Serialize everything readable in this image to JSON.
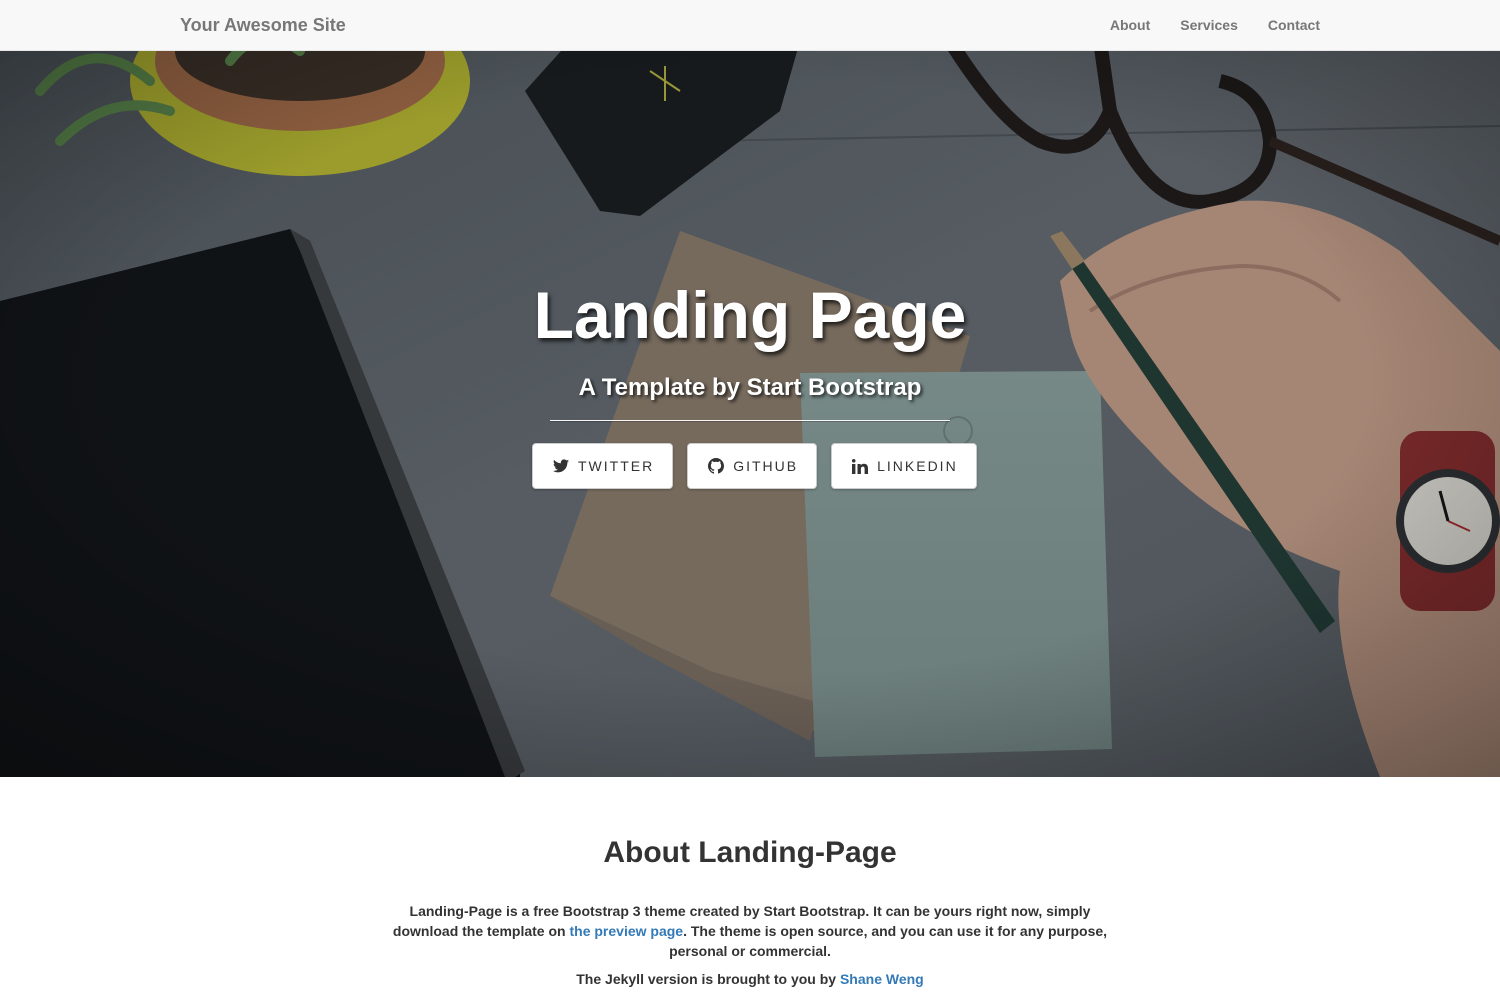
{
  "navbar": {
    "brand": "Your Awesome Site",
    "links": [
      "About",
      "Services",
      "Contact"
    ]
  },
  "hero": {
    "title": "Landing Page",
    "subtitle": "A Template by Start Bootstrap",
    "buttons": [
      {
        "label": "TWITTER",
        "icon": "twitter-icon"
      },
      {
        "label": "GITHUB",
        "icon": "github-icon"
      },
      {
        "label": "LINKEDIN",
        "icon": "linkedin-icon"
      }
    ]
  },
  "about": {
    "title": "About Landing-Page",
    "body_1": "Landing-Page is a free Bootstrap 3 theme created by Start Bootstrap. It can be yours right now, simply download the template on ",
    "body_link": "the preview page",
    "body_2": ". The theme is open source, and you can use it for any purpose, personal or commercial.",
    "credit_text": "The Jekyll version is brought to you by ",
    "credit_link": "Shane Weng"
  },
  "colors": {
    "navbar_bg": "#f8f8f8",
    "nav_text": "#777777",
    "link": "#337ab7",
    "text": "#333333"
  }
}
